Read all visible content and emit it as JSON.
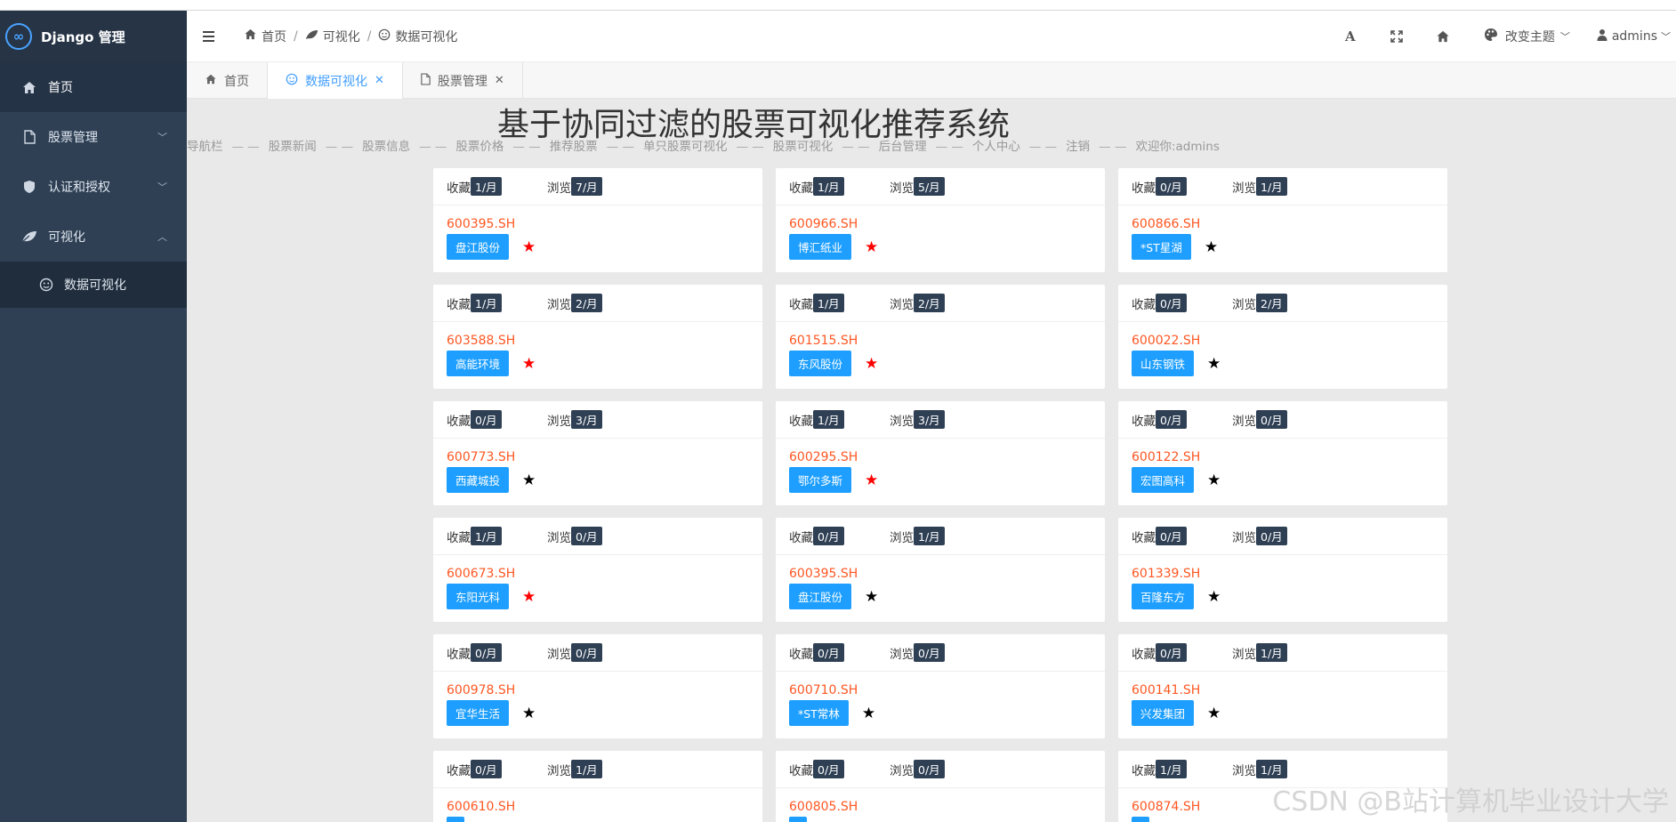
{
  "brand": {
    "title": "Django 管理"
  },
  "sidebar": {
    "items": [
      {
        "label": "首页",
        "icon": "home-icon"
      },
      {
        "label": "股票管理",
        "icon": "file-icon"
      },
      {
        "label": "认证和授权",
        "icon": "shield-icon"
      },
      {
        "label": "可视化",
        "icon": "leaf-icon"
      }
    ],
    "sub_item": {
      "label": "数据可视化",
      "icon": "smile-icon"
    }
  },
  "breadcrumb": {
    "home": "首页",
    "viz": "可视化",
    "data_viz": "数据可视化"
  },
  "header": {
    "theme": "改变主题",
    "user": "admins"
  },
  "tabs": [
    {
      "label": "首页"
    },
    {
      "label": "数据可视化"
    },
    {
      "label": "股票管理"
    }
  ],
  "main": {
    "title": "基于协同过滤的股票可视化推荐系统",
    "nav": [
      "导航栏",
      "股票新闻",
      "股票信息",
      "股票价格",
      "推荐股票",
      "单只股票可视化",
      "股票可视化",
      "后台管理",
      "个人中心",
      "注销",
      "欢迎你:admins"
    ],
    "nav_sep": "— —",
    "collect_label": "收藏",
    "browse_label": "浏览"
  },
  "cards": [
    {
      "collect": "1/月",
      "browse": "7/月",
      "code": "600395.SH",
      "name": "盘江股份",
      "star_color": "#ff0000"
    },
    {
      "collect": "1/月",
      "browse": "5/月",
      "code": "600966.SH",
      "name": "博汇纸业",
      "star_color": "#ff0000"
    },
    {
      "collect": "0/月",
      "browse": "1/月",
      "code": "600866.SH",
      "name": "*ST星湖",
      "star_color": "#000000"
    },
    {
      "collect": "1/月",
      "browse": "2/月",
      "code": "603588.SH",
      "name": "高能环境",
      "star_color": "#ff0000"
    },
    {
      "collect": "1/月",
      "browse": "2/月",
      "code": "601515.SH",
      "name": "东风股份",
      "star_color": "#ff0000"
    },
    {
      "collect": "0/月",
      "browse": "2/月",
      "code": "600022.SH",
      "name": "山东钢铁",
      "star_color": "#000000"
    },
    {
      "collect": "0/月",
      "browse": "3/月",
      "code": "600773.SH",
      "name": "西藏城投",
      "star_color": "#000000"
    },
    {
      "collect": "1/月",
      "browse": "3/月",
      "code": "600295.SH",
      "name": "鄂尔多斯",
      "star_color": "#ff0000"
    },
    {
      "collect": "0/月",
      "browse": "0/月",
      "code": "600122.SH",
      "name": "宏图高科",
      "star_color": "#000000"
    },
    {
      "collect": "1/月",
      "browse": "0/月",
      "code": "600673.SH",
      "name": "东阳光科",
      "star_color": "#ff0000"
    },
    {
      "collect": "0/月",
      "browse": "1/月",
      "code": "600395.SH",
      "name": "盘江股份",
      "star_color": "#000000"
    },
    {
      "collect": "0/月",
      "browse": "0/月",
      "code": "601339.SH",
      "name": "百隆东方",
      "star_color": "#000000"
    },
    {
      "collect": "0/月",
      "browse": "0/月",
      "code": "600978.SH",
      "name": "宜华生活",
      "star_color": "#000000"
    },
    {
      "collect": "0/月",
      "browse": "0/月",
      "code": "600710.SH",
      "name": "*ST常林",
      "star_color": "#000000"
    },
    {
      "collect": "0/月",
      "browse": "1/月",
      "code": "600141.SH",
      "name": "兴发集团",
      "star_color": "#000000"
    },
    {
      "collect": "0/月",
      "browse": "1/月",
      "code": "600610.SH",
      "name": "",
      "star_color": "#000000"
    },
    {
      "collect": "0/月",
      "browse": "0/月",
      "code": "600805.SH",
      "name": "",
      "star_color": "#000000"
    },
    {
      "collect": "1/月",
      "browse": "1/月",
      "code": "600874.SH",
      "name": "",
      "star_color": "#000000"
    }
  ],
  "star_glyph": "★",
  "watermark": "CSDN @B站计算机毕业设计大学"
}
